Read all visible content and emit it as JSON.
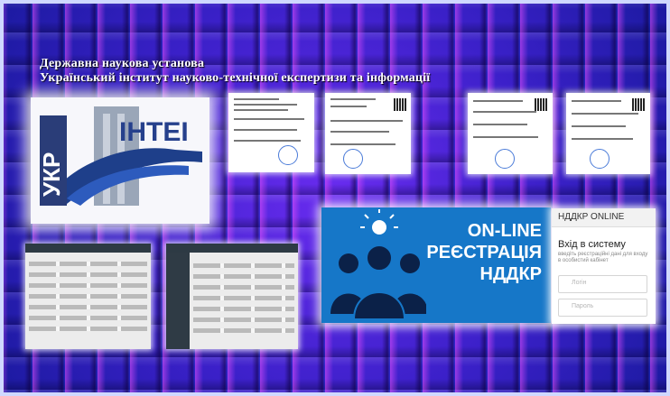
{
  "header": {
    "line1": "Державна наукова установа",
    "line2": "Український інститут науково-технічної експертизи та інформації"
  },
  "logo": {
    "alt_word": "УКР",
    "brand": "ІНТЕІ"
  },
  "banner": {
    "line1": "ON-LINE",
    "line2": "РЕЄСТРАЦІЯ",
    "line3": "НДДКР"
  },
  "login": {
    "title": "НДДКР ONLINE",
    "heading": "Вхід в систему",
    "subtitle": "введіть реєстраційні дані для входу в особистий кабінет",
    "login_placeholder": "Логін",
    "password_placeholder": "Пароль"
  },
  "colors": {
    "bg": "#3a1fb8",
    "banner": "#1677c8"
  }
}
